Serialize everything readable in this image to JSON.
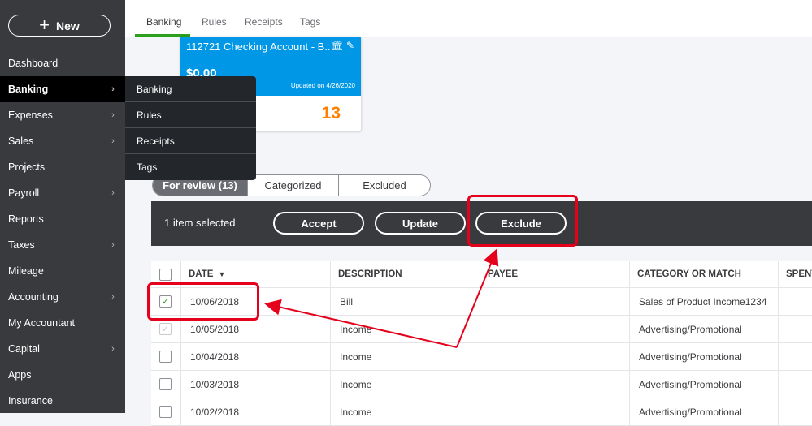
{
  "sidebar": {
    "new_label": "New",
    "items": [
      {
        "label": "Dashboard",
        "chevron": false,
        "active": false
      },
      {
        "label": "Banking",
        "chevron": true,
        "active": true
      },
      {
        "label": "Expenses",
        "chevron": true,
        "active": false
      },
      {
        "label": "Sales",
        "chevron": true,
        "active": false
      },
      {
        "label": "Projects",
        "chevron": false,
        "active": false
      },
      {
        "label": "Payroll",
        "chevron": true,
        "active": false
      },
      {
        "label": "Reports",
        "chevron": false,
        "active": false
      },
      {
        "label": "Taxes",
        "chevron": true,
        "active": false
      },
      {
        "label": "Mileage",
        "chevron": false,
        "active": false
      },
      {
        "label": "Accounting",
        "chevron": true,
        "active": false
      },
      {
        "label": "My Accountant",
        "chevron": false,
        "active": false
      },
      {
        "label": "Capital",
        "chevron": true,
        "active": false
      },
      {
        "label": "Apps",
        "chevron": false,
        "active": false
      },
      {
        "label": "Insurance",
        "chevron": false,
        "active": false
      }
    ]
  },
  "flyout": {
    "items": [
      "Banking",
      "Rules",
      "Receipts",
      "Tags"
    ]
  },
  "tabs": [
    {
      "label": "Banking",
      "active": true
    },
    {
      "label": "Rules",
      "active": false
    },
    {
      "label": "Receipts",
      "active": false
    },
    {
      "label": "Tags",
      "active": false
    }
  ],
  "account_card": {
    "name": "112721 Checking Account - B..",
    "icons": [
      "bank-icon",
      "pencil-icon"
    ],
    "balance": "$0.00",
    "updated": "Updated on 4/26/2020",
    "pending_count": "13",
    "color": "#0097e6"
  },
  "review_tabs": [
    {
      "label": "For review (13)",
      "active": true
    },
    {
      "label": "Categorized",
      "active": false
    },
    {
      "label": "Excluded",
      "active": false
    }
  ],
  "batch_bar": {
    "selected_text": "1 item selected",
    "accept_label": "Accept",
    "update_label": "Update",
    "exclude_label": "Exclude"
  },
  "table": {
    "headers": {
      "date": "DATE",
      "sort_indicator": "▼",
      "description": "DESCRIPTION",
      "payee": "PAYEE",
      "category": "CATEGORY OR MATCH",
      "spent": "SPENT"
    },
    "rows": [
      {
        "checked": true,
        "faded": false,
        "date": "10/06/2018",
        "description": "Bill",
        "payee": "",
        "category": "Sales of Product Income1234"
      },
      {
        "checked": true,
        "faded": true,
        "date": "10/05/2018",
        "description": "Income",
        "payee": "",
        "category": "Advertising/Promotional"
      },
      {
        "checked": false,
        "faded": false,
        "date": "10/04/2018",
        "description": "Income",
        "payee": "",
        "category": "Advertising/Promotional"
      },
      {
        "checked": false,
        "faded": false,
        "date": "10/03/2018",
        "description": "Income",
        "payee": "",
        "category": "Advertising/Promotional"
      },
      {
        "checked": false,
        "faded": false,
        "date": "10/02/2018",
        "description": "Income",
        "payee": "",
        "category": "Advertising/Promotional"
      }
    ]
  },
  "colors": {
    "sidebar_bg": "#393a3d",
    "accent_green": "#2ca01c",
    "highlight_red": "#e5001b",
    "count_orange": "#ff8000"
  }
}
